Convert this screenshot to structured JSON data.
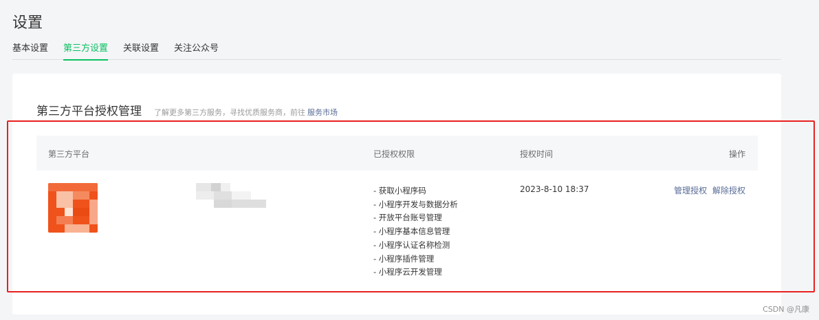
{
  "page": {
    "title": "设置"
  },
  "tabs": [
    {
      "label": "基本设置",
      "active": false
    },
    {
      "label": "第三方设置",
      "active": true
    },
    {
      "label": "关联设置",
      "active": false
    },
    {
      "label": "关注公众号",
      "active": false
    }
  ],
  "section": {
    "title": "第三方平台授权管理",
    "description": "了解更多第三方服务，寻找优质服务商，前往",
    "link": "服务市场"
  },
  "table": {
    "headers": {
      "platform": "第三方平台",
      "permissions": "已授权权限",
      "time": "授权时间",
      "actions": "操作"
    },
    "rows": [
      {
        "permissions": [
          "- 获取小程序码",
          "- 小程序开发与数据分析",
          "- 开放平台账号管理",
          "- 小程序基本信息管理",
          "- 小程序认证名称检测",
          "- 小程序插件管理",
          "- 小程序云开发管理"
        ],
        "time": "2023-8-10 18:37",
        "actions": {
          "manage": "管理授权",
          "revoke": "解除授权"
        }
      }
    ]
  },
  "watermark": "CSDN @凡康",
  "colors": {
    "accent": "#07c160",
    "link": "#576b95",
    "highlight_frame": "#e8201d",
    "avatar": "#f0521b"
  }
}
